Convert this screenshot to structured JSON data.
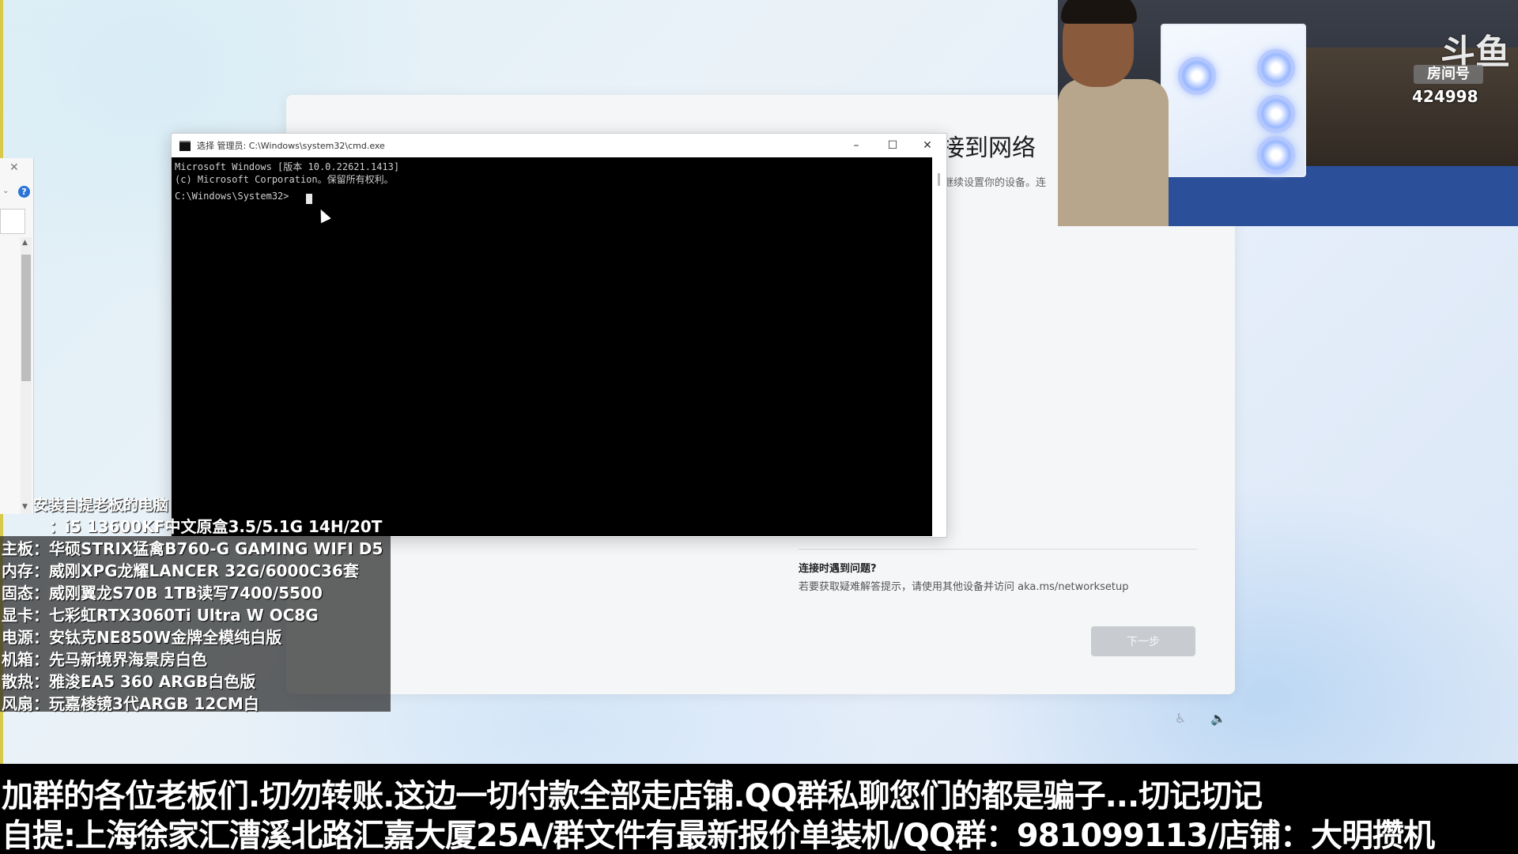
{
  "cmd": {
    "title": "选择 管理员: C:\\Windows\\system32\\cmd.exe",
    "lines": [
      "Microsoft Windows [版本 10.0.22621.1413]",
      "(c) Microsoft Corporation。保留所有权利。"
    ],
    "prompt": "C:\\Windows\\System32>",
    "minimize": "–",
    "maximize": "☐",
    "close": "✕"
  },
  "oobe": {
    "title": "接到网络",
    "subtitle": "继续设置你的设备。连",
    "question": "连接时遇到问题?",
    "hint": "若要获取疑难解答提示，请使用其他设备并访问 aka.ms/networksetup",
    "next_label": "下一步"
  },
  "webcam": {
    "logo": "斗鱼",
    "room_label": "房间号",
    "room_number": "424998"
  },
  "specs": {
    "title": "安装自提老板的电脑",
    "lines": [
      "：i5 13600KF中文原盒3.5/5.1G 14H/20T",
      "主板：华硕STRIX猛禽B760-G GAMING WIFI D5",
      "内存：威刚XPG龙耀LANCER 32G/6000C36套",
      "固态：威刚翼龙S70B 1TB读写7400/5500",
      "显卡：七彩虹RTX3060Ti Ultra W OC8G",
      "电源：安钛克NE850W金牌全模纯白版",
      "机箱：先马新境界海景房白色",
      "散热：雅浚EA5 360 ARGB白色版",
      "风扇：玩嘉棱镜3代ARGB 12CM白"
    ]
  },
  "ticker": {
    "line1": "加群的各位老板们.切勿转账.这边一切付款全部走店铺.QQ群私聊您们的都是骗子...切记切记",
    "line2": "自提:上海徐家汇漕溪北路汇嘉大厦25A/群文件有最新报价单装机/QQ群：981099113/店铺：大明攒机"
  },
  "left_panel": {
    "close": "✕",
    "help": "?",
    "chevron": "⌄",
    "scroll_up": "▲",
    "scroll_down": "▼"
  }
}
